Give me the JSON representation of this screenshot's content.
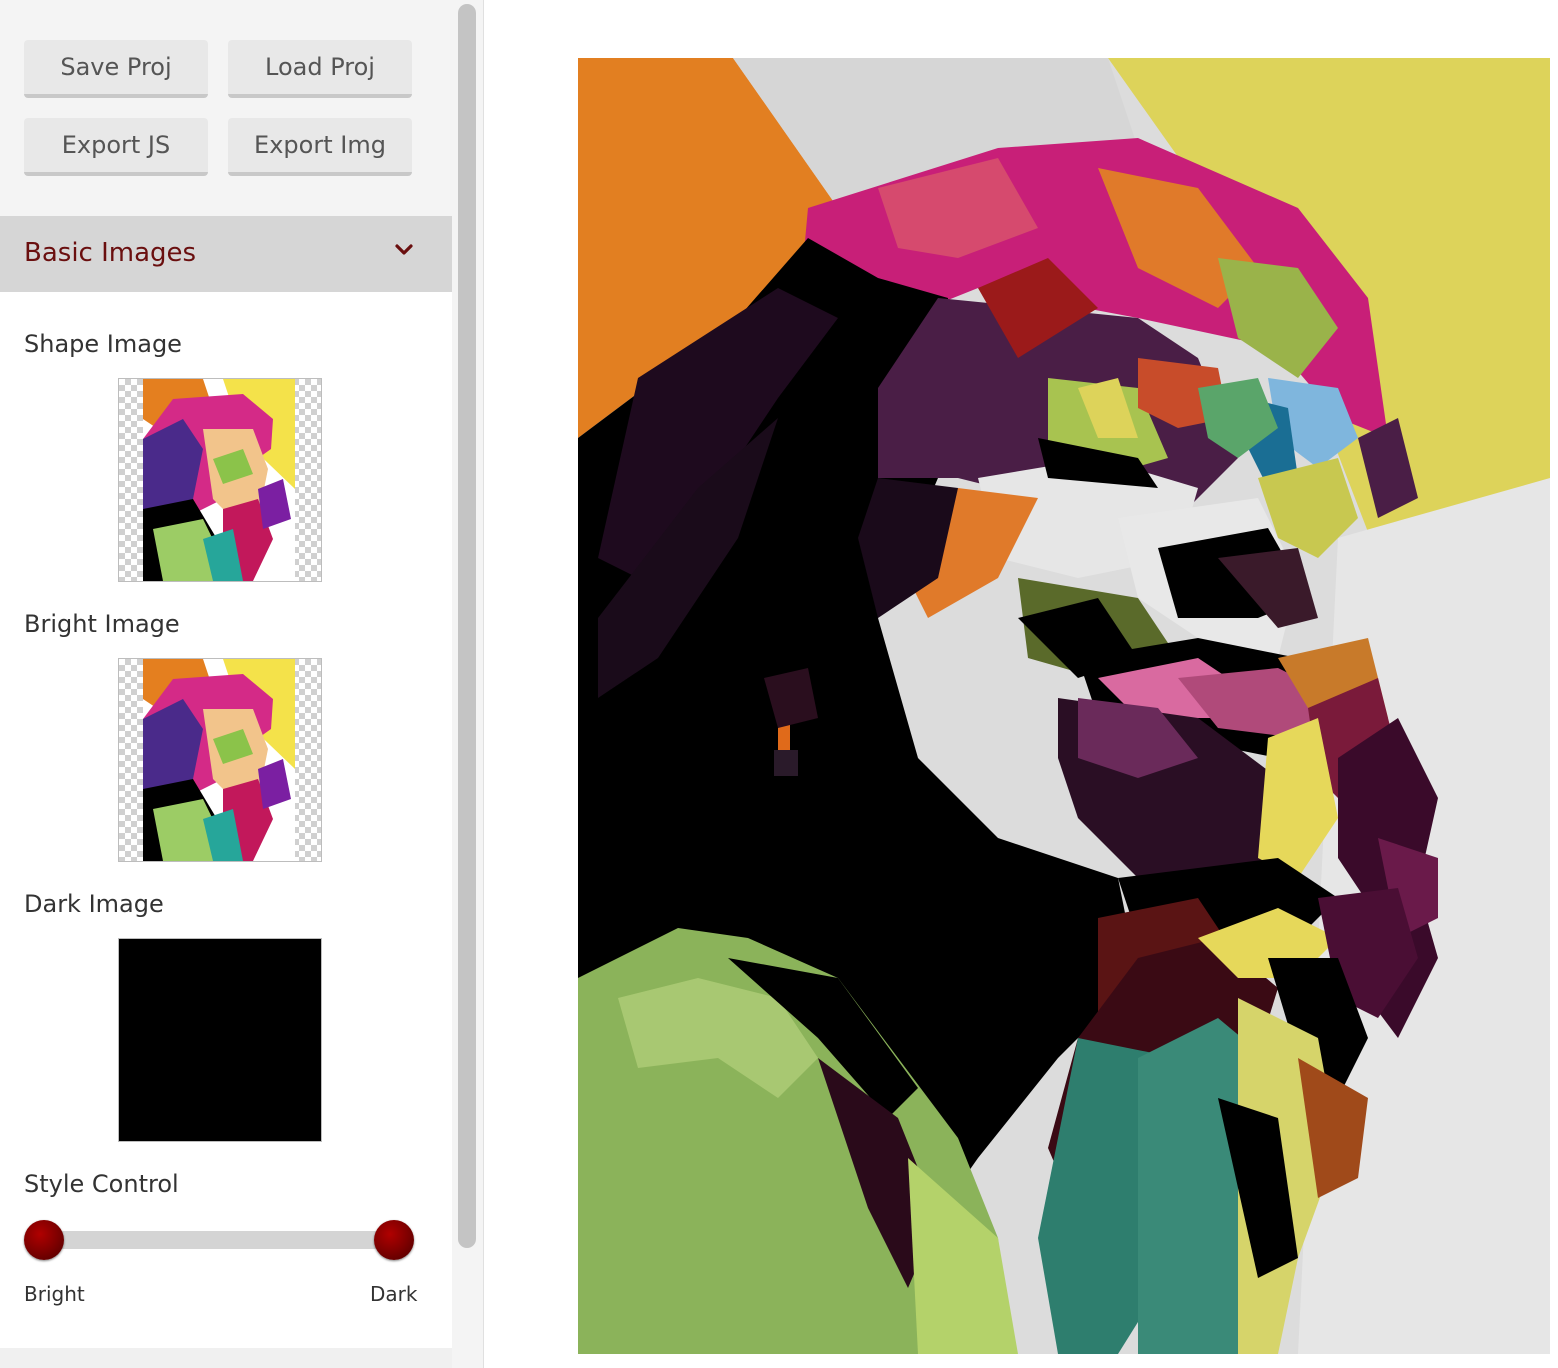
{
  "toolbar": {
    "save_label": "Save Proj",
    "load_label": "Load Proj",
    "export_js_label": "Export JS",
    "export_img_label": "Export Img"
  },
  "section": {
    "title": "Basic Images",
    "icon": "chevron-down-icon"
  },
  "images": {
    "shape_label": "Shape Image",
    "bright_label": "Bright Image",
    "dark_label": "Dark Image"
  },
  "style_control": {
    "label": "Style Control",
    "min_label": "Bright",
    "max_label": "Dark",
    "range_low": 0,
    "range_high": 1
  },
  "colors": {
    "accent": "#7a0000",
    "section_title": "#6a0f0f",
    "header_bg": "#d6d6d6"
  }
}
